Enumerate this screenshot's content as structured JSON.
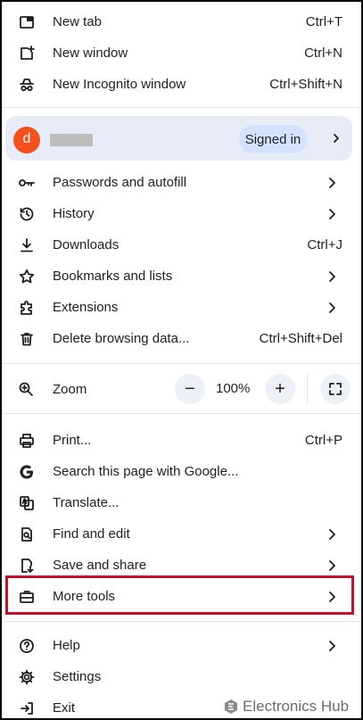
{
  "menu": {
    "new_tab": {
      "label": "New tab",
      "shortcut": "Ctrl+T",
      "icon": "new-tab-icon"
    },
    "new_window": {
      "label": "New window",
      "shortcut": "Ctrl+N",
      "icon": "new-window-icon"
    },
    "new_incognito": {
      "label": "New Incognito window",
      "shortcut": "Ctrl+Shift+N",
      "icon": "incognito-icon"
    },
    "profile": {
      "avatar_letter": "d",
      "status": "Signed in",
      "avatar_color": "#f4511e"
    },
    "passwords": {
      "label": "Passwords and autofill",
      "icon": "key-icon"
    },
    "history": {
      "label": "History",
      "icon": "history-icon"
    },
    "downloads": {
      "label": "Downloads",
      "shortcut": "Ctrl+J",
      "icon": "download-icon"
    },
    "bookmarks": {
      "label": "Bookmarks and lists",
      "icon": "star-icon"
    },
    "extensions": {
      "label": "Extensions",
      "icon": "puzzle-icon"
    },
    "delete_data": {
      "label": "Delete browsing data...",
      "shortcut": "Ctrl+Shift+Del",
      "icon": "trash-icon"
    },
    "zoom": {
      "label": "Zoom",
      "value": "100%",
      "minus": "−",
      "plus": "+",
      "icon": "zoom-icon"
    },
    "print": {
      "label": "Print...",
      "shortcut": "Ctrl+P",
      "icon": "printer-icon"
    },
    "search_google": {
      "label": "Search this page with Google...",
      "icon": "google-icon"
    },
    "translate": {
      "label": "Translate...",
      "icon": "translate-icon"
    },
    "find_edit": {
      "label": "Find and edit",
      "icon": "find-icon"
    },
    "save_share": {
      "label": "Save and share",
      "icon": "save-icon"
    },
    "more_tools": {
      "label": "More tools",
      "icon": "toolbox-icon"
    },
    "help": {
      "label": "Help",
      "icon": "help-icon"
    },
    "settings": {
      "label": "Settings",
      "icon": "gear-icon"
    },
    "exit": {
      "label": "Exit",
      "icon": "exit-icon"
    }
  },
  "watermark": {
    "text": "Electronics Hub"
  },
  "colors": {
    "highlight": "#c8102e",
    "profile_bg": "#e7ecf6",
    "signed_in_bg": "#d3e3fd"
  }
}
